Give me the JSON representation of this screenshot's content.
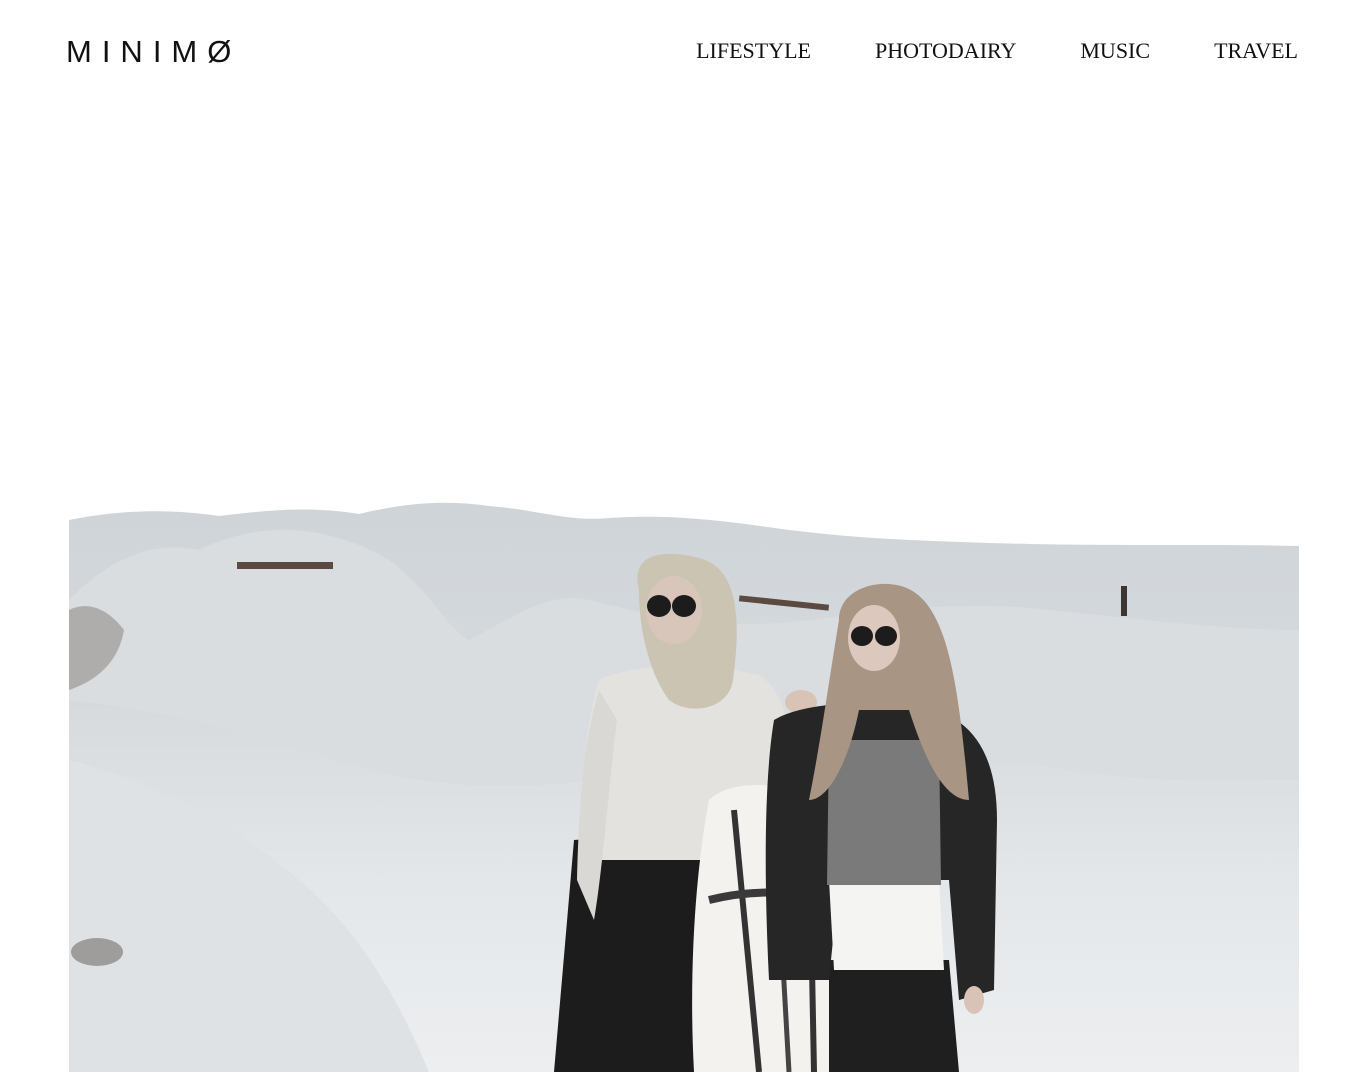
{
  "site": {
    "logo": "MINIMØ"
  },
  "nav": {
    "items": [
      {
        "label": "LIFESTYLE"
      },
      {
        "label": "PHOTODAIRY"
      },
      {
        "label": "MUSIC"
      },
      {
        "label": "TRAVEL"
      }
    ]
  },
  "hero": {
    "image_icon": "photo-two-women-on-dunes"
  },
  "colors": {
    "background": "#ffffff",
    "text": "#111111",
    "sand": "#e6e9eb",
    "shadow": "#c9ced2",
    "dark": "#1e1e1e"
  }
}
